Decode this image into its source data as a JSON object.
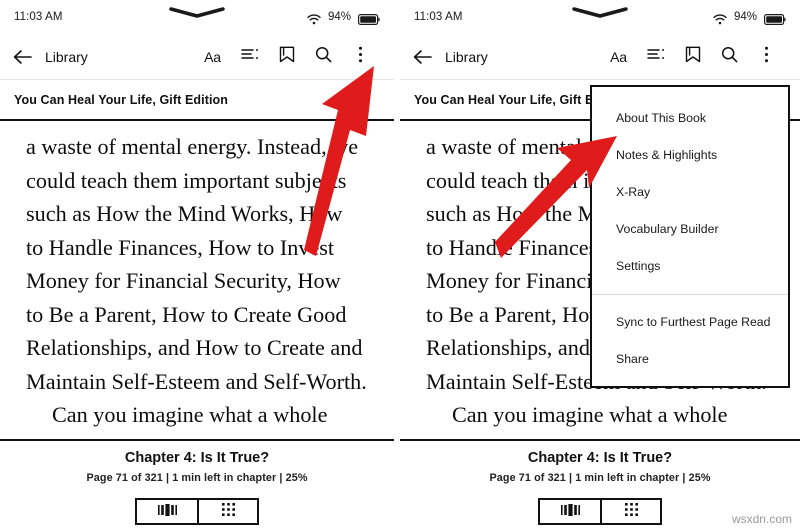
{
  "status_bar": {
    "time": "11:03 AM",
    "battery_percent": "94%",
    "wifi_icon": "wifi-icon",
    "battery_icon": "battery-icon",
    "notch_icon": "notch-indicator"
  },
  "toolbar": {
    "back_icon": "back-arrow-icon",
    "library_label": "Library",
    "icons": [
      {
        "name": "font-size-icon",
        "glyph": "Aa"
      },
      {
        "name": "table-of-contents-icon",
        "glyph": ""
      },
      {
        "name": "bookmark-icon",
        "glyph": ""
      },
      {
        "name": "search-icon",
        "glyph": ""
      },
      {
        "name": "more-options-icon",
        "glyph": ""
      }
    ]
  },
  "book": {
    "title": "You Can Heal Your Life, Gift Edition",
    "paragraphs": [
      "a waste of mental energy. Instead, we\ncould teach them important subjects\nsuch as How the Mind Works, How\nto Handle Finances, How to Invest\nMoney for Financial Security, How\nto Be a Parent, How to Create Good\nRelationships, and How to Create and\nMaintain Self-Esteem and Self-Worth.",
      "Can you imagine what a whole\ngeneration of adults would be like if\nthey had been taught these subjects"
    ]
  },
  "footer": {
    "chapter": "Chapter 4: Is It True?",
    "page_info": "Page 71 of 321 | 1 min left in chapter | 25%",
    "nav_buttons": [
      {
        "name": "page-view-button",
        "icon": "page-bars-icon"
      },
      {
        "name": "grid-view-button",
        "icon": "grid-icon"
      }
    ]
  },
  "menu": {
    "items": [
      {
        "label": "About This Book",
        "name": "menu-item-about-this-book"
      },
      {
        "label": "Notes & Highlights",
        "name": "menu-item-notes-and-highlights"
      },
      {
        "label": "X-Ray",
        "name": "menu-item-x-ray"
      },
      {
        "label": "Vocabulary Builder",
        "name": "menu-item-vocabulary-builder"
      },
      {
        "label": "Settings",
        "name": "menu-item-settings"
      }
    ],
    "items_secondary": [
      {
        "label": "Sync to Furthest Page Read",
        "name": "menu-item-sync-to-furthest-page-read"
      },
      {
        "label": "Share",
        "name": "menu-item-share"
      }
    ]
  },
  "annotations": {
    "arrow_color": "#e01b1b",
    "arrow_1_target": "more-options-icon",
    "arrow_2_target": "menu-item-notes-and-highlights"
  },
  "watermark": "wsxdn.com"
}
